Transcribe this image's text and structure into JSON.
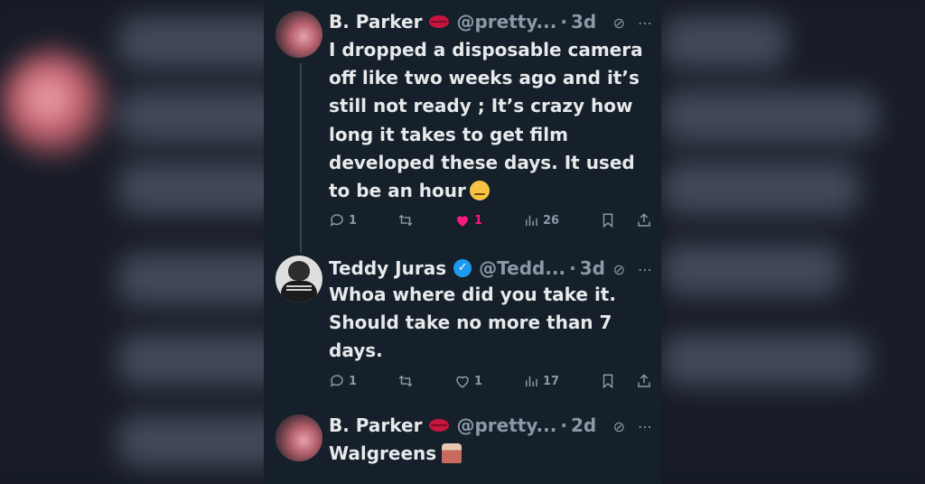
{
  "tweets": [
    {
      "name": "B. Parker",
      "handle": "@pretty...",
      "time": "3d",
      "text": "I dropped a disposable camera off like two weeks ago and it’s still not ready ; It’s crazy how long it takes to get film developed these days. It used to be an hour",
      "emoji_icon": "woozy-face-emoji",
      "replies": "1",
      "retweets": "",
      "likes": "1",
      "liked": true,
      "views": "26"
    },
    {
      "name": "Teddy Juras",
      "handle": "@Tedd...",
      "time": "3d",
      "verified": true,
      "text": "Whoa where did you take it. Should take no more than 7 days.",
      "replies": "1",
      "retweets": "",
      "likes": "1",
      "liked": false,
      "views": "17"
    },
    {
      "name": "B. Parker",
      "handle": "@pretty...",
      "time": "2d",
      "text": "Walgreens",
      "emoji_icon": "birthday-cake-emoji"
    }
  ],
  "colors": {
    "background": "#15202b",
    "text": "#e7e9ea",
    "muted": "#8b98a5",
    "like": "#f91880",
    "verified": "#1d9bf0"
  }
}
